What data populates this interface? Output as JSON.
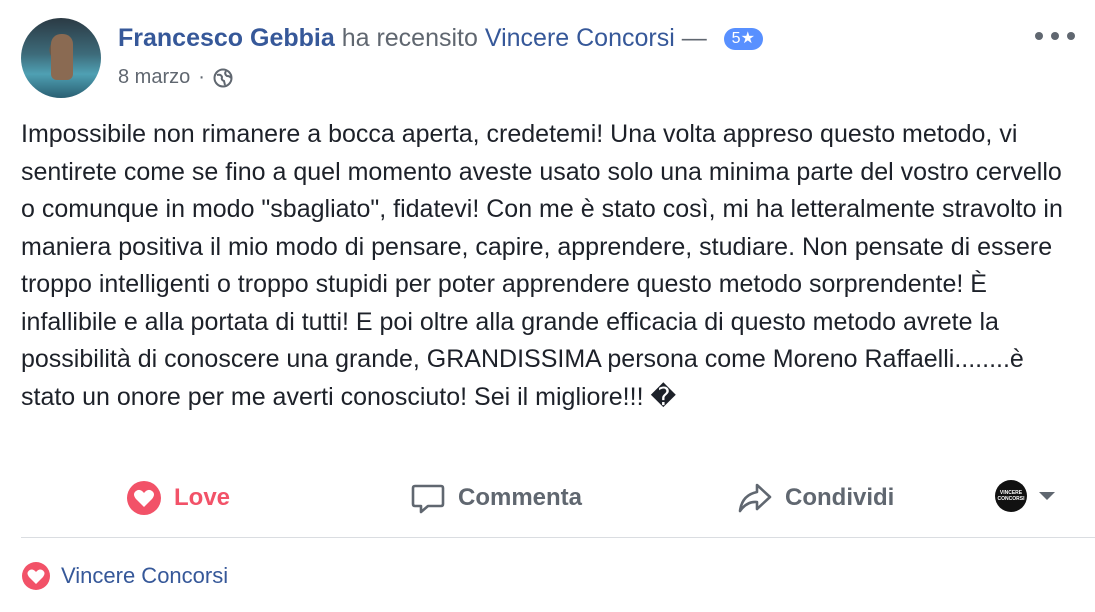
{
  "post": {
    "author": "Francesco Gebbia",
    "verb": "ha recensito",
    "page": "Vincere Concorsi",
    "dash": "—",
    "rating": "5★",
    "date": "8 marzo",
    "separator": "·",
    "privacy_icon": "globe-icon",
    "more_icon": "more-options-icon",
    "text": "Impossibile non rimanere a bocca aperta, credetemi! Una volta appreso questo metodo, vi sentirete come se fino a quel momento aveste usato solo una minima parte del vostro cervello o comunque in modo \"sbagliato\", fidatevi! Con me è stato così, mi ha letteralmente stravolto in maniera positiva il mio modo di pensare, capire, apprendere, studiare. Non pensate di essere troppo intelligenti o troppo stupidi per poter apprendere questo metodo sorprendente! È infallibile e alla portata di tutti! E poi oltre alla grande efficacia di questo metodo avrete la possibilità di conoscere una grande, GRANDISSIMA persona come Moreno Raffaelli........è stato un onore per me averti conosciuto! Sei il migliore!!! �"
  },
  "actions": {
    "love_label": "Love",
    "comment_label": "Commenta",
    "share_label": "Condividi",
    "page_avatar_text": "VINCERE CONCORSI"
  },
  "reactions": {
    "icon": "love-icon",
    "names": "Vincere Concorsi"
  },
  "colors": {
    "link": "#365899",
    "love": "#f25268",
    "badge": "#5890ff",
    "secondary_text": "#606770"
  }
}
